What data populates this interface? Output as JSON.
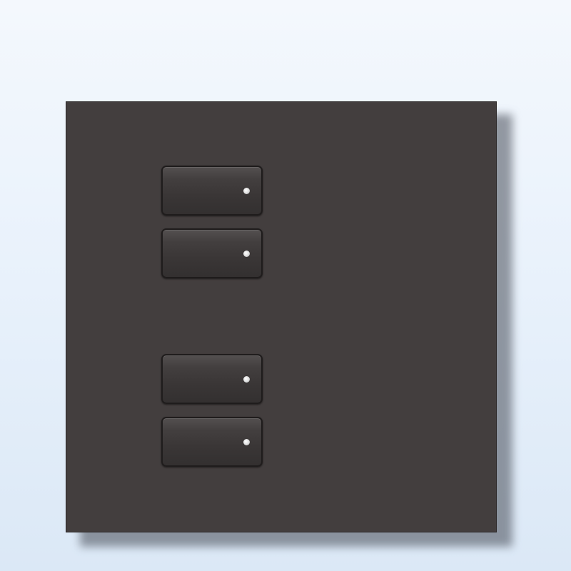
{
  "keypad": {
    "plate_color": "#433e3e",
    "key_color": "#3a3636",
    "led_color": "#e6e6e6",
    "buttons": [
      {
        "id": "button-1",
        "led": "led-indicator"
      },
      {
        "id": "button-2",
        "led": "led-indicator"
      },
      {
        "id": "button-3",
        "led": "led-indicator"
      },
      {
        "id": "button-4",
        "led": "led-indicator"
      }
    ]
  }
}
